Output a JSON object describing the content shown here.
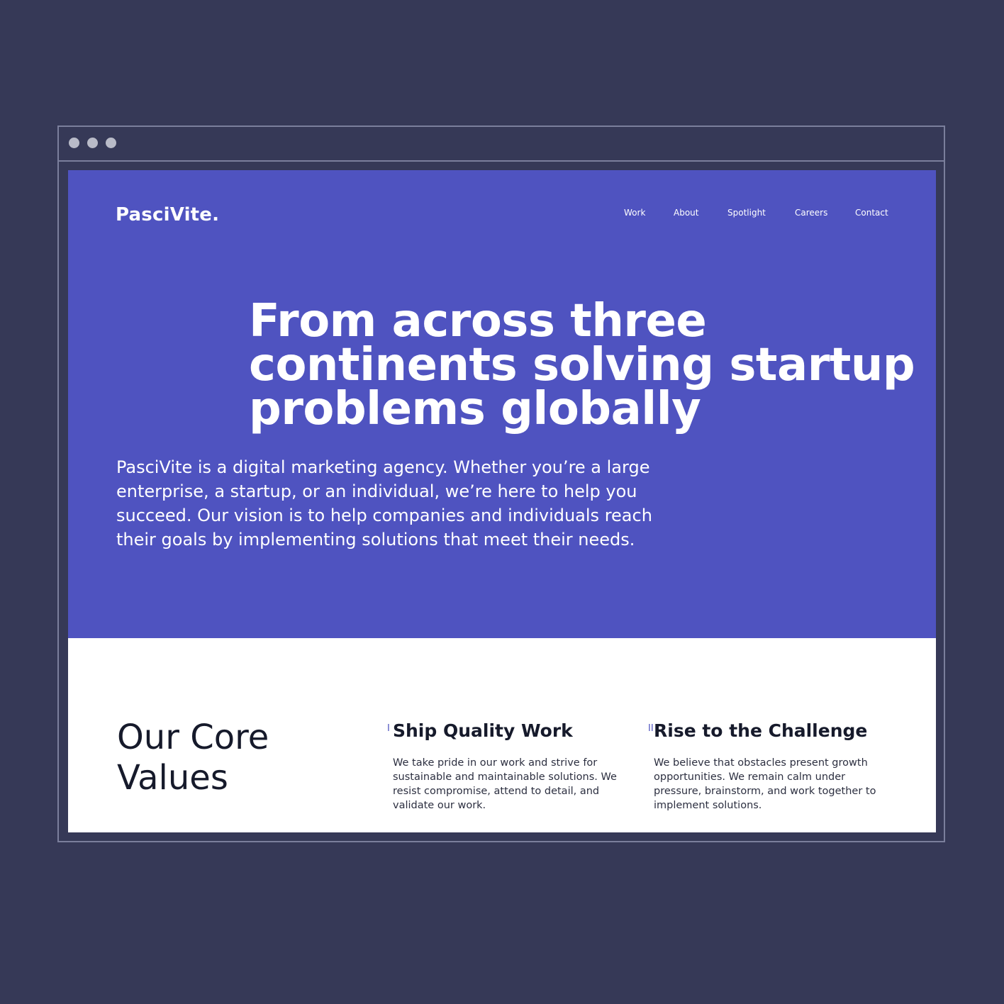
{
  "browser": {
    "window_controls": [
      "window-dot",
      "window-dot",
      "window-dot"
    ]
  },
  "header": {
    "logo": "PasciVite.",
    "nav": [
      "Work",
      "About",
      "Spotlight",
      "Careers",
      "Contact"
    ]
  },
  "hero": {
    "headline": "From across three continents solving startup problems globally",
    "intro": "PasciVite is a digital marketing agency. Whether you’re a large enterprise, a startup, or an individual, we’re here to help you succeed. Our vision is to help companies and individuals reach their goals by implementing solutions that meet their needs."
  },
  "core_values": {
    "title": "Our Core Values",
    "items": [
      {
        "marker": "I",
        "title": "Ship Quality Work",
        "text": "We take pride in our work and strive for sustainable and maintainable solutions. We resist compromise, attend to detail, and validate our work."
      },
      {
        "marker": "II",
        "title": "Rise to the Challenge",
        "text": "We believe that obstacles present growth opportunities. We remain calm under pressure, brainstorm, and work together to implement solutions."
      }
    ]
  },
  "colors": {
    "background": "#363957",
    "brand": "#4f53c0",
    "text_dark": "#161a2b",
    "white": "#ffffff"
  }
}
